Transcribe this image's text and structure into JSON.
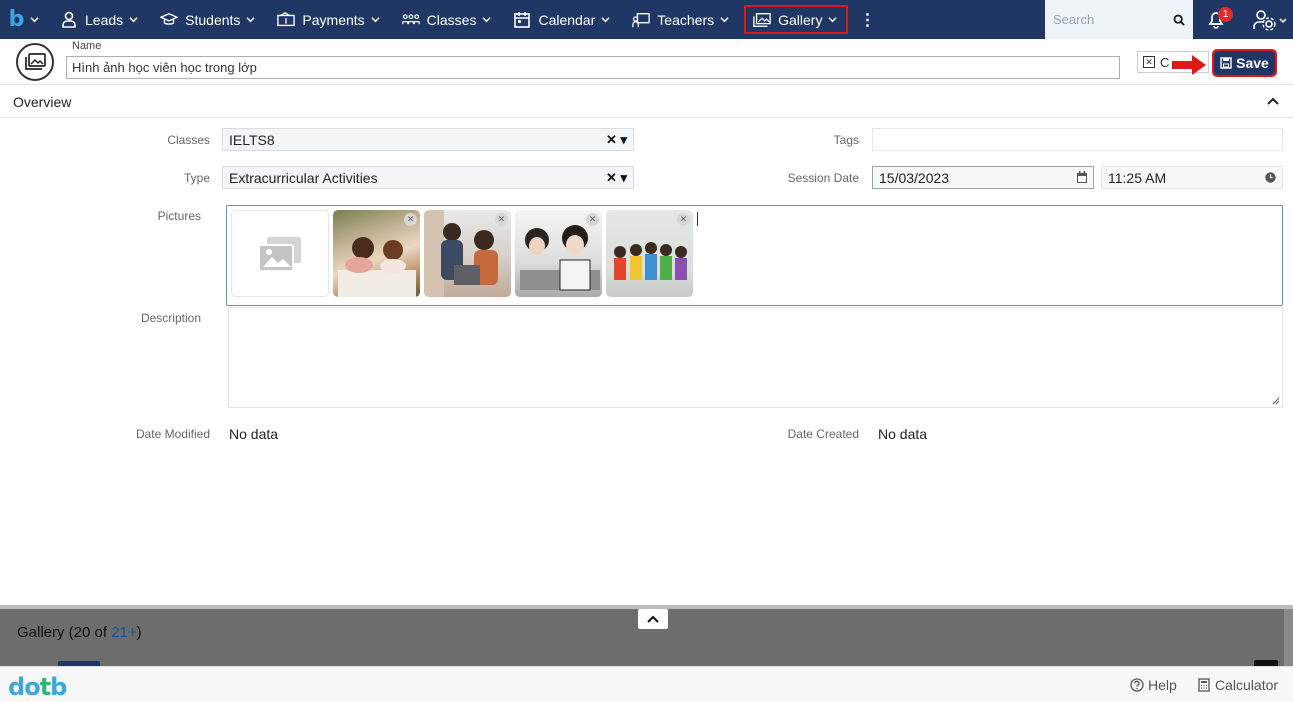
{
  "nav": {
    "brand": "b",
    "items": [
      {
        "label": "Leads",
        "icon": "user-icon"
      },
      {
        "label": "Students",
        "icon": "graduation-cap-icon"
      },
      {
        "label": "Payments",
        "icon": "payments-icon"
      },
      {
        "label": "Classes",
        "icon": "classes-icon"
      },
      {
        "label": "Calendar",
        "icon": "calendar-icon"
      },
      {
        "label": "Teachers",
        "icon": "teacher-board-icon"
      },
      {
        "label": "Gallery",
        "icon": "gallery-icon",
        "active": true
      }
    ],
    "search_placeholder": "Search",
    "notification_count": "1"
  },
  "record": {
    "name_label": "Name",
    "name_value": "Hình ảnh học viên học trong lớp",
    "cancel_label": "Cancel",
    "cancel_visible": "C",
    "save_label": "Save"
  },
  "overview": {
    "title": "Overview",
    "classes_label": "Classes",
    "classes_value": "IELTS8",
    "type_label": "Type",
    "type_value": "Extracurricular Activities",
    "tags_label": "Tags",
    "tags_value": "",
    "session_date_label": "Session Date",
    "session_date_value": "15/03/2023",
    "session_time_value": "11:25 AM",
    "pictures_label": "Pictures",
    "description_label": "Description",
    "date_modified_label": "Date Modified",
    "date_modified_value": "No data",
    "date_created_label": "Date Created",
    "date_created_value": "No data"
  },
  "bottom_panel": {
    "title_prefix": "Gallery (20 of ",
    "title_count": "21+",
    "title_suffix": ")"
  },
  "footer": {
    "brand": "dotb",
    "help_label": "Help",
    "calculator_label": "Calculator"
  },
  "colors": {
    "nav_bg": "#203766",
    "accent": "#3aa7e3",
    "highlight": "#e01818"
  }
}
